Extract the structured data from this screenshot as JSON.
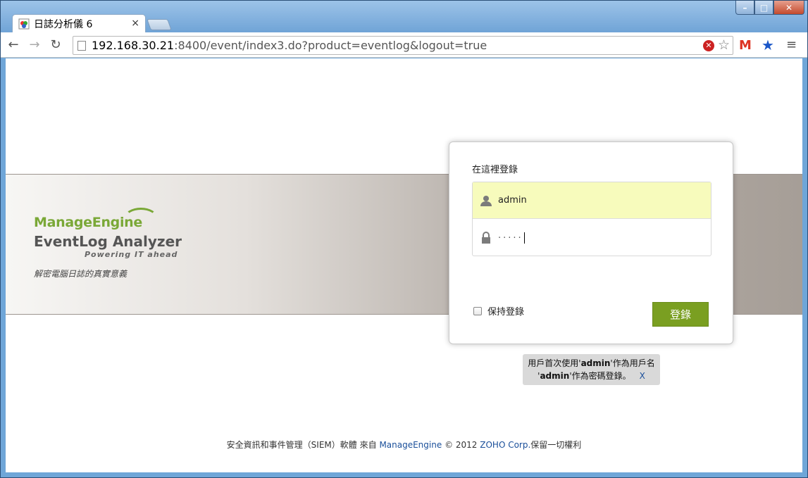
{
  "browser": {
    "tab_title": "日誌分析儀 6",
    "tab_close": "×",
    "url_host": "192.168.30.21",
    "url_rest": ":8400/event/index3.do?product=eventlog&logout=true",
    "window_controls": {
      "minimize": "–",
      "maximize": "□",
      "close": "✕"
    }
  },
  "brand": {
    "manage": "Manage",
    "engine": "Engine",
    "product": "EventLog Analyzer",
    "powering": "Powering IT ahead",
    "tagline": "解密電腦日誌的真實意義"
  },
  "login": {
    "title": "在這裡登錄",
    "username": "admin",
    "password_mask": "·····",
    "keep_label": "保持登錄",
    "submit_label": "登錄"
  },
  "hint": {
    "line1_prefix": "用戶首次使用'",
    "line1_bold": "admin",
    "line1_suffix": "'作為用戶名",
    "line2_prefix": "'",
    "line2_bold": "admin",
    "line2_suffix": "'作為密碼登錄。",
    "close": "X"
  },
  "footer": {
    "part1": "安全資訊和事件管理（SIEM）軟體",
    "part2": "來自",
    "link1": "ManageEngine",
    "part3": "© 2012",
    "link2": "ZOHO Corp.",
    "part4": "保留一切權利"
  },
  "colors": {
    "accent_green": "#7a9f21",
    "user_field_bg": "#f7fbbc",
    "link_blue": "#1a4f9a"
  }
}
